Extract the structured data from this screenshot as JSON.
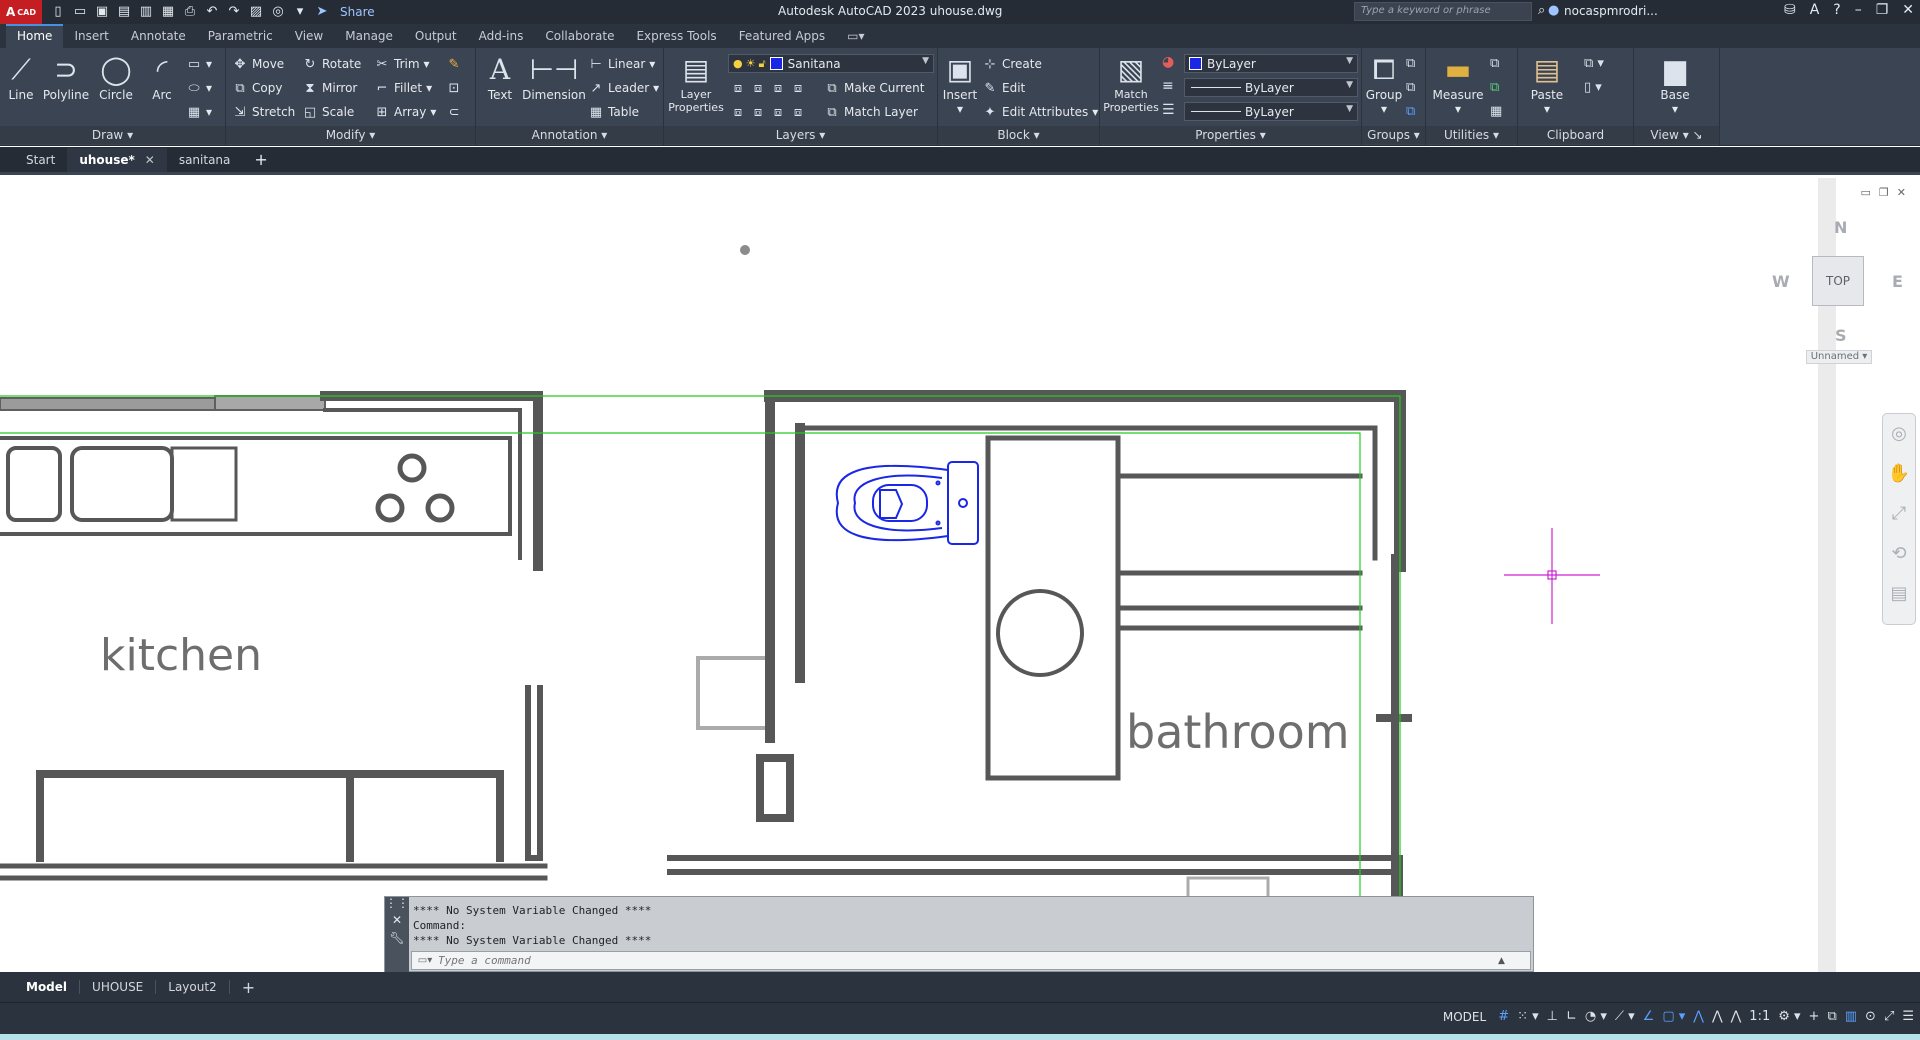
{
  "app": {
    "logo_text": "A",
    "logo_sub": "CAD",
    "title": "Autodesk AutoCAD 2023   uhouse.dwg",
    "share": "Share",
    "search_placeholder": "Type a keyword or phrase",
    "user": "nocaspmrodri..."
  },
  "ribbon_tabs": [
    "Home",
    "Insert",
    "Annotate",
    "Parametric",
    "View",
    "Manage",
    "Output",
    "Add-ins",
    "Collaborate",
    "Express Tools",
    "Featured Apps"
  ],
  "panels": {
    "draw": {
      "title": "Draw",
      "line": "Line",
      "polyline": "Polyline",
      "circle": "Circle",
      "arc": "Arc"
    },
    "modify": {
      "title": "Modify",
      "move": "Move",
      "rotate": "Rotate",
      "trim": "Trim",
      "copy": "Copy",
      "mirror": "Mirror",
      "fillet": "Fillet",
      "stretch": "Stretch",
      "scale": "Scale",
      "array": "Array"
    },
    "annotation": {
      "title": "Annotation",
      "text": "Text",
      "dimension": "Dimension",
      "linear": "Linear",
      "leader": "Leader",
      "table": "Table"
    },
    "layers": {
      "title": "Layers",
      "layer_properties": "Layer Properties",
      "current_layer": "Sanitana",
      "make_current": "Make Current",
      "match_layer": "Match Layer"
    },
    "block": {
      "title": "Block",
      "insert": "Insert",
      "create": "Create",
      "edit": "Edit",
      "edit_attributes": "Edit Attributes"
    },
    "properties": {
      "title": "Properties",
      "match_properties": "Match Properties",
      "color": "ByLayer",
      "linetype": "ByLayer",
      "lineweight": "ByLayer"
    },
    "groups": {
      "title": "Groups",
      "group": "Group"
    },
    "utilities": {
      "title": "Utilities",
      "measure": "Measure"
    },
    "clipboard": {
      "title": "Clipboard",
      "paste": "Paste"
    },
    "view": {
      "title": "View",
      "base": "Base"
    }
  },
  "doc_tabs": {
    "start": "Start",
    "active": "uhouse*",
    "other": "sanitana"
  },
  "drawing": {
    "kitchen_label": "kitchen",
    "bathroom_label": "bathroom"
  },
  "viewcube": {
    "n": "N",
    "s": "S",
    "e": "E",
    "w": "W",
    "top": "TOP",
    "ucs": "Unnamed"
  },
  "command": {
    "history": [
      "**** No System Variable Changed ****",
      "Command:",
      "**** No System Variable Changed ****"
    ],
    "placeholder": "Type a command"
  },
  "layout_tabs": [
    "Model",
    "UHOUSE",
    "Layout2"
  ],
  "status": {
    "model": "MODEL",
    "scale": "1:1"
  },
  "colors": {
    "ribbon": "#3b4452",
    "titlebar": "#252c36",
    "selection_blue": "#1a27e6",
    "crosshair": "#d020d0",
    "viewport_green": "#22cc22"
  }
}
